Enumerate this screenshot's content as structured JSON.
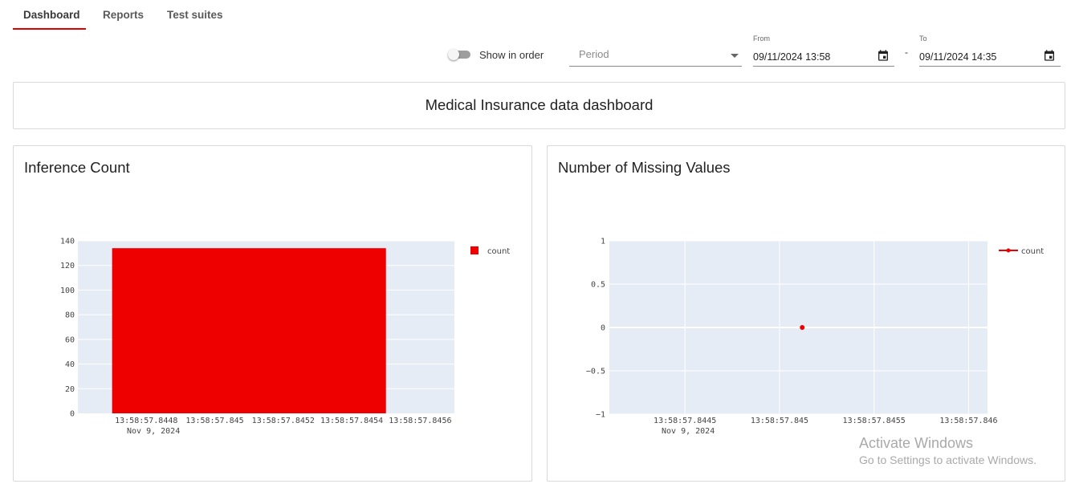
{
  "tabs": [
    {
      "label": "Dashboard",
      "active": true
    },
    {
      "label": "Reports",
      "active": false
    },
    {
      "label": "Test suites",
      "active": false
    }
  ],
  "accent_color": "#e00000",
  "controls": {
    "show_in_order_label": "Show in order",
    "show_in_order_checked": false,
    "period_placeholder": "Period",
    "from": {
      "label": "From",
      "value": "09/11/2024 13:58"
    },
    "separator": "-",
    "to": {
      "label": "To",
      "value": "09/11/2024 14:35"
    }
  },
  "dashboard_title": "Medical Insurance data dashboard",
  "charts": {
    "inference": {
      "title": "Inference Count",
      "legend": "count"
    },
    "missing": {
      "title": "Number of Missing Values",
      "legend": "count"
    }
  },
  "chart_data": [
    {
      "type": "bar",
      "title": "Inference Count",
      "x_tick_labels": [
        "13:58:57.8448",
        "13:58:57.845",
        "13:58:57.8452",
        "13:58:57.8454",
        "13:58:57.8456"
      ],
      "x_date_label": "Nov 9, 2024",
      "x_range_ms": [
        57.8446,
        57.8457
      ],
      "x_ticks_ms": [
        57.8448,
        57.845,
        57.8452,
        57.8454,
        57.8456
      ],
      "bar": {
        "x_start_ms": 57.8447,
        "x_end_ms": 57.8455,
        "value": 134
      },
      "series": [
        {
          "name": "count",
          "color": "#ee0000"
        }
      ],
      "ylim": [
        0,
        140
      ],
      "y_ticks": [
        0,
        20,
        40,
        60,
        80,
        100,
        120,
        140
      ],
      "grid": true,
      "legend_position": "top-right"
    },
    {
      "type": "scatter",
      "title": "Number of Missing Values",
      "x_tick_labels": [
        "13:58:57.8445",
        "13:58:57.845",
        "13:58:57.8455",
        "13:58:57.846"
      ],
      "x_date_label": "Nov 9, 2024",
      "x_range_ms": [
        57.8441,
        57.8461
      ],
      "x_ticks_ms": [
        57.8445,
        57.845,
        57.8455,
        57.846
      ],
      "points": [
        {
          "x_ms": 57.84512,
          "y": 0
        }
      ],
      "series": [
        {
          "name": "count",
          "color": "#ee0000"
        }
      ],
      "ylim": [
        -1,
        1
      ],
      "y_ticks": [
        -1,
        -0.5,
        0,
        0.5,
        1
      ],
      "y_tick_labels": [
        "−1",
        "−0.5",
        "0",
        "0.5",
        "1"
      ],
      "grid": true,
      "legend_position": "top-right"
    }
  ],
  "watermark": {
    "line1": "Activate Windows",
    "line2": "Go to Settings to activate Windows."
  }
}
